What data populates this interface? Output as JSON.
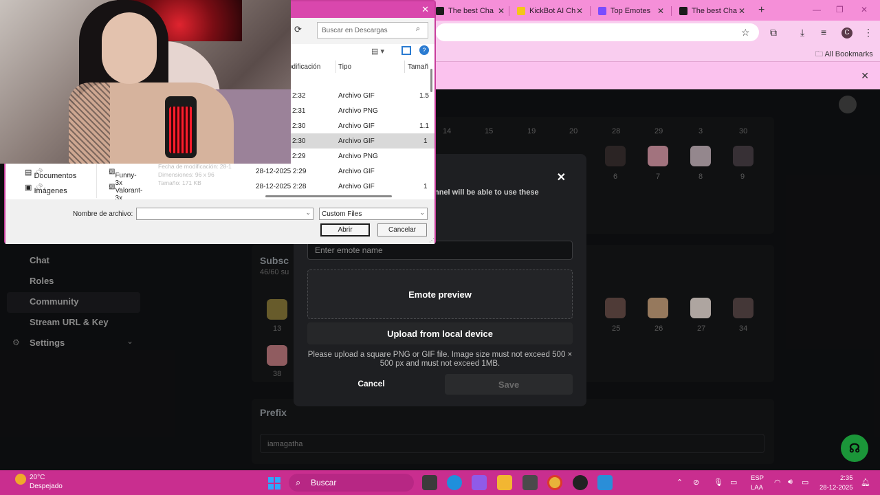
{
  "browser": {
    "tabs": [
      {
        "label": "The best Cha",
        "color": "#1b1b1b"
      },
      {
        "label": "KickBot AI Ch",
        "color": "#f5c518"
      },
      {
        "label": "Top Emotes",
        "color": "#7a4cff"
      },
      {
        "label": "The best Cha",
        "color": "#1b1b1b"
      }
    ],
    "bookmarks_label": "All Bookmarks",
    "profile_initial": "C"
  },
  "sidebar": {
    "items": [
      {
        "label": "Chat"
      },
      {
        "label": "Roles"
      },
      {
        "label": "Community"
      },
      {
        "label": "Stream URL & Key"
      },
      {
        "label": "Settings"
      }
    ]
  },
  "emote_grid": {
    "top_days": [
      "14",
      "15",
      "19",
      "20",
      "28",
      "29",
      "3",
      "30"
    ],
    "top_numbers": [
      "6",
      "7",
      "8",
      "9"
    ],
    "sub_numbers": [
      "13",
      "25",
      "26",
      "27",
      "34",
      "38"
    ]
  },
  "sections": {
    "subscriber_title": "Subsc",
    "subscriber_count": "46/60 su",
    "prefix_title": "Prefix",
    "prefix_value": "iamagatha"
  },
  "modal": {
    "description": "nnel will be able to use these",
    "name_placeholder": "Enter emote name",
    "preview_label": "Emote preview",
    "upload_label": "Upload from local device",
    "hint": "Please upload a square PNG or GIF file. Image size must not exceed 500 × 500 px and must not exceed 1MB.",
    "cancel_label": "Cancel",
    "save_label": "Save"
  },
  "file_dialog": {
    "search_placeholder": "Buscar en Descargas",
    "columns": {
      "modified": "odificación",
      "type": "Tipo",
      "size": "Tamañ"
    },
    "rows": [
      {
        "time": "2:32",
        "type": "Archivo GIF",
        "size": "1.5"
      },
      {
        "time": "2:31",
        "type": "Archivo PNG",
        "size": ""
      },
      {
        "time": "2:30",
        "type": "Archivo GIF",
        "size": "1.1"
      },
      {
        "time": "2:30",
        "type": "Archivo GIF",
        "size": "1"
      },
      {
        "time": "2:29",
        "type": "Archivo PNG",
        "size": ""
      },
      {
        "name": "Funny-3x",
        "time": "28-12-2025 2:29",
        "type": "Archivo GIF",
        "size": ""
      },
      {
        "name": "Valorant-3x",
        "time": "28-12-2025 2:28",
        "type": "Archivo GIF",
        "size": "1"
      }
    ],
    "nav": [
      {
        "label": "Documentos"
      },
      {
        "label": "Imágenes"
      }
    ],
    "tooltip": [
      "Fecha de modificación: 28-1",
      "Dimensiones: 96 x 96",
      "Tamaño: 171 KB"
    ],
    "filename_label": "Nombre de archivo:",
    "filter_value": "Custom Files",
    "open_label": "Abrir",
    "cancel_label": "Cancelar"
  },
  "taskbar": {
    "temp": "20°C",
    "weather": "Despejado",
    "search": "Buscar",
    "lang1": "ESP",
    "lang2": "LAA",
    "time": "2:35",
    "date": "28-12-2025"
  }
}
